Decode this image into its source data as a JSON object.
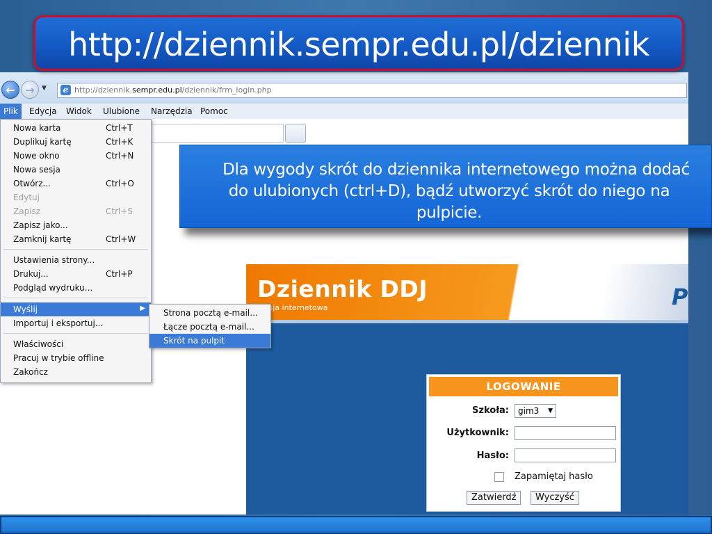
{
  "slide": {
    "title": "http://dziennik.sempr.edu.pl/dziennik",
    "callout_text": "Dla wygody skrót do dziennika internetowego można dodać do ulubionych (ctrl+D), bądź utworzyć skrót do niego na pulpicie."
  },
  "browser": {
    "address": {
      "prefix": "http://dziennik.",
      "domain": "sempr.edu.pl",
      "path": "/dziennik/frm_login.php"
    },
    "menubar": [
      "Plik",
      "Edycja",
      "Widok",
      "Ulubione",
      "Narzędzia",
      "Pomoc"
    ],
    "file_menu": [
      {
        "label": "Nowa karta",
        "shortcut": "Ctrl+T"
      },
      {
        "label": "Duplikuj kartę",
        "shortcut": "Ctrl+K"
      },
      {
        "label": "Nowe okno",
        "shortcut": "Ctrl+N"
      },
      {
        "label": "Nowa sesja",
        "shortcut": ""
      },
      {
        "label": "Otwórz...",
        "shortcut": "Ctrl+O"
      },
      {
        "label": "Edytuj",
        "shortcut": ""
      },
      {
        "label": "Zapisz",
        "shortcut": "Ctrl+S"
      },
      {
        "label": "Zapisz jako...",
        "shortcut": ""
      },
      {
        "label": "Zamknij kartę",
        "shortcut": "Ctrl+W"
      },
      {
        "label": "Ustawienia strony...",
        "shortcut": ""
      },
      {
        "label": "Drukuj...",
        "shortcut": "Ctrl+P"
      },
      {
        "label": "Podgląd wydruku...",
        "shortcut": ""
      },
      {
        "label": "Wyślij",
        "shortcut": ""
      },
      {
        "label": "Importuj i eksportuj...",
        "shortcut": ""
      },
      {
        "label": "Właściwości",
        "shortcut": ""
      },
      {
        "label": "Pracuj w trybie offline",
        "shortcut": ""
      },
      {
        "label": "Zakończ",
        "shortcut": ""
      }
    ],
    "send_submenu": [
      "Strona pocztą e-mail...",
      "Łącze pocztą e-mail...",
      "Skrót na pulpit"
    ]
  },
  "ddj": {
    "title": "Dziennik DDJ",
    "subtitle": "rsja internetowa",
    "corner_letter": "P",
    "login": {
      "header": "LOGOWANIE",
      "school_label": "Szkoła:",
      "school_value": "gim3",
      "user_label": "Użytkownik:",
      "password_label": "Hasło:",
      "remember_label": "Zapamiętaj hasło",
      "submit_label": "Zatwierdź",
      "clear_label": "Wyczyść"
    }
  },
  "colors": {
    "accent_orange": "#f7941d",
    "selection_blue": "#3b7ad6",
    "title_border": "#c8102e"
  }
}
